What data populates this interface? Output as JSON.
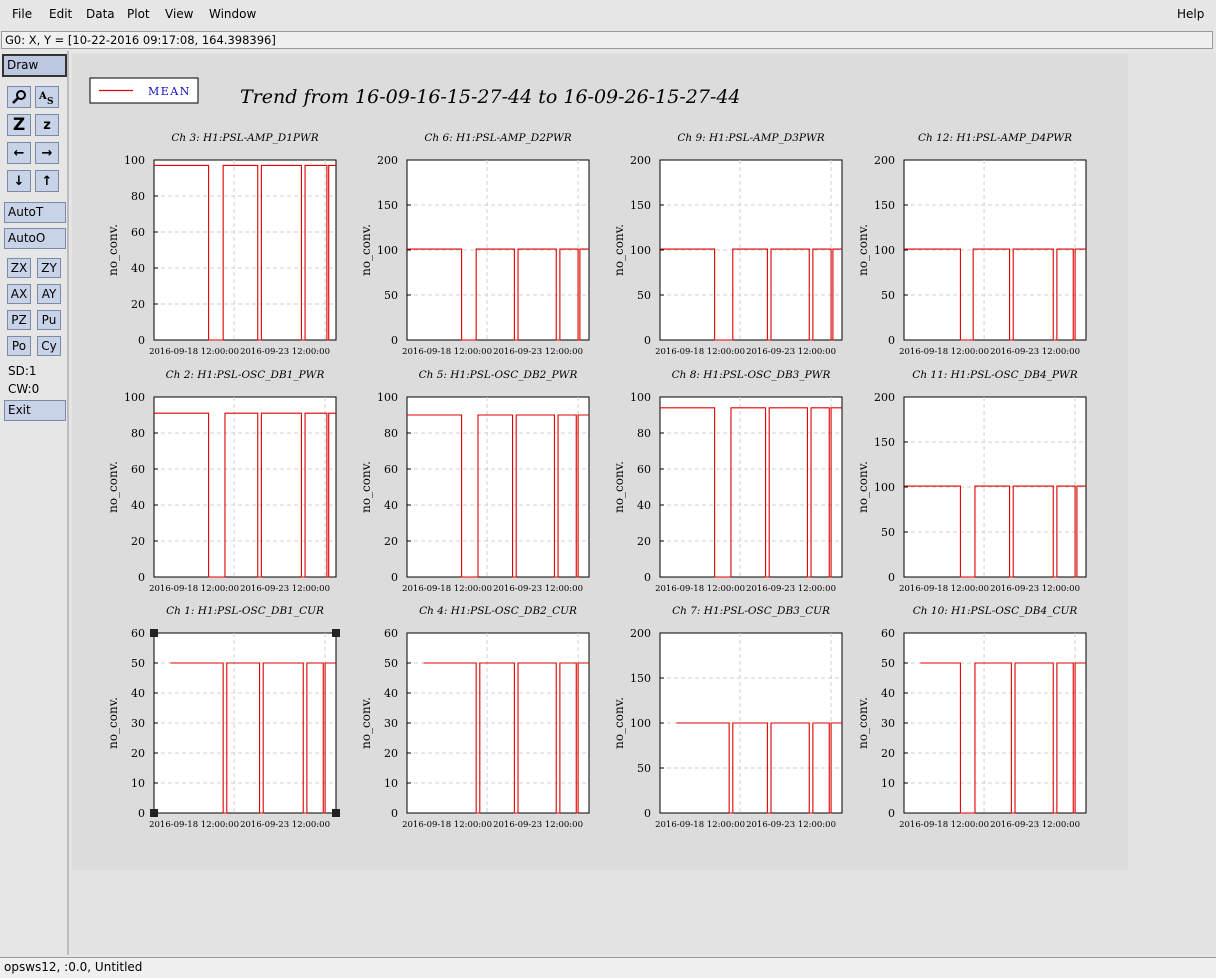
{
  "menu": {
    "file": "File",
    "edit": "Edit",
    "data": "Data",
    "plot": "Plot",
    "view": "View",
    "window": "Window",
    "help": "Help"
  },
  "coord_readout": "G0: X, Y = [10-22-2016 09:17:08, 164.398396]",
  "toolbar": {
    "draw": "Draw",
    "icons": [
      "magnifier-icon",
      "text-icon",
      "zoom-z-large-icon",
      "zoom-z-small-icon",
      "arrow-left-icon",
      "arrow-right-icon",
      "arrow-down-icon",
      "arrow-up-icon"
    ],
    "autot": "AutoT",
    "autoo": "AutoO",
    "zx": "ZX",
    "zy": "ZY",
    "ax": "AX",
    "ay": "AY",
    "pz": "PZ",
    "pu": "Pu",
    "po": "Po",
    "cy": "Cy",
    "sd": "SD:1",
    "cw": "CW:0",
    "exit": "Exit"
  },
  "figure": {
    "title": "Trend from 16-09-16-15-27-44 to 16-09-26-15-27-44",
    "legend": "MEAN",
    "series_color": "#e00000"
  },
  "status_bar": "opsws12, :0.0, Untitled",
  "chart_data": [
    {
      "type": "line",
      "title": "Ch 3: H1:PSL-AMP_D1PWR",
      "ylabel": "no_conv.",
      "ylim": [
        0,
        100
      ],
      "yticks": [
        0,
        20,
        40,
        60,
        80,
        100
      ],
      "xticks": [
        "2016-09-18 12:00:00",
        "2016-09-23 12:00:00"
      ],
      "level": 97,
      "start": 0.0,
      "drops": [
        [
          0.3,
          0.38
        ],
        [
          0.57,
          0.59
        ],
        [
          0.81,
          0.83
        ],
        [
          0.95,
          0.96
        ]
      ],
      "series": [
        {
          "name": "MEAN",
          "values": [
            97,
            97,
            0,
            97,
            0,
            97,
            0,
            97,
            0,
            97
          ]
        }
      ]
    },
    {
      "type": "line",
      "title": "Ch 6: H1:PSL-AMP_D2PWR",
      "ylabel": "no_conv.",
      "ylim": [
        0,
        200
      ],
      "yticks": [
        0,
        50,
        100,
        150,
        200
      ],
      "xticks": [
        "2016-09-18 12:00:00",
        "2016-09-23 12:00:00"
      ],
      "level": 101,
      "start": 0.0,
      "drops": [
        [
          0.3,
          0.38
        ],
        [
          0.59,
          0.61
        ],
        [
          0.82,
          0.84
        ],
        [
          0.94,
          0.95
        ]
      ],
      "series": [
        {
          "name": "MEAN",
          "values": [
            101,
            101,
            0,
            101,
            0,
            101,
            0,
            101,
            0,
            101
          ]
        }
      ]
    },
    {
      "type": "line",
      "title": "Ch 9: H1:PSL-AMP_D3PWR",
      "ylabel": "no_conv.",
      "ylim": [
        0,
        200
      ],
      "yticks": [
        0,
        50,
        100,
        150,
        200
      ],
      "xticks": [
        "2016-09-18 12:00:00",
        "2016-09-23 12:00:00"
      ],
      "level": 101,
      "start": 0.0,
      "drops": [
        [
          0.3,
          0.4
        ],
        [
          0.59,
          0.61
        ],
        [
          0.82,
          0.84
        ],
        [
          0.94,
          0.95
        ]
      ],
      "series": [
        {
          "name": "MEAN",
          "values": [
            101,
            101,
            0,
            101,
            0,
            101,
            0,
            101,
            0,
            101
          ]
        }
      ]
    },
    {
      "type": "line",
      "title": "Ch 12: H1:PSL-AMP_D4PWR",
      "ylabel": "no_conv.",
      "ylim": [
        0,
        200
      ],
      "yticks": [
        0,
        50,
        100,
        150,
        200
      ],
      "xticks": [
        "2016-09-18 12:00:00",
        "2016-09-23 12:00:00"
      ],
      "level": 101,
      "start": 0.0,
      "drops": [
        [
          0.31,
          0.38
        ],
        [
          0.58,
          0.6
        ],
        [
          0.82,
          0.84
        ],
        [
          0.93,
          0.94
        ]
      ],
      "series": [
        {
          "name": "MEAN",
          "values": [
            101,
            101,
            0,
            101,
            0,
            101,
            0,
            101,
            0,
            101
          ]
        }
      ]
    },
    {
      "type": "line",
      "title": "Ch 2: H1:PSL-OSC_DB1_PWR",
      "ylabel": "no_conv.",
      "ylim": [
        0,
        100
      ],
      "yticks": [
        0,
        20,
        40,
        60,
        80,
        100
      ],
      "xticks": [
        "2016-09-18 12:00:00",
        "2016-09-23 12:00:00"
      ],
      "level": 91,
      "start": 0.0,
      "drops": [
        [
          0.3,
          0.39
        ],
        [
          0.57,
          0.59
        ],
        [
          0.81,
          0.83
        ],
        [
          0.95,
          0.96
        ]
      ],
      "series": [
        {
          "name": "MEAN",
          "values": [
            91,
            91,
            0,
            91,
            0,
            91,
            0,
            91,
            0,
            91
          ]
        }
      ]
    },
    {
      "type": "line",
      "title": "Ch 5: H1:PSL-OSC_DB2_PWR",
      "ylabel": "no_conv.",
      "ylim": [
        0,
        100
      ],
      "yticks": [
        0,
        20,
        40,
        60,
        80,
        100
      ],
      "xticks": [
        "2016-09-18 12:00:00",
        "2016-09-23 12:00:00"
      ],
      "level": 90,
      "start": 0.0,
      "drops": [
        [
          0.3,
          0.39
        ],
        [
          0.58,
          0.6
        ],
        [
          0.81,
          0.83
        ],
        [
          0.93,
          0.94
        ]
      ],
      "series": [
        {
          "name": "MEAN",
          "values": [
            90,
            90,
            0,
            90,
            0,
            90,
            0,
            90,
            0,
            90
          ]
        }
      ]
    },
    {
      "type": "line",
      "title": "Ch 8: H1:PSL-OSC_DB3_PWR",
      "ylabel": "no_conv.",
      "ylim": [
        0,
        100
      ],
      "yticks": [
        0,
        20,
        40,
        60,
        80,
        100
      ],
      "xticks": [
        "2016-09-18 12:00:00",
        "2016-09-23 12:00:00"
      ],
      "level": 94,
      "start": 0.0,
      "drops": [
        [
          0.3,
          0.39
        ],
        [
          0.58,
          0.6
        ],
        [
          0.81,
          0.83
        ],
        [
          0.93,
          0.94
        ]
      ],
      "series": [
        {
          "name": "MEAN",
          "values": [
            94,
            94,
            0,
            94,
            0,
            94,
            0,
            94,
            0,
            94
          ]
        }
      ]
    },
    {
      "type": "line",
      "title": "Ch 11: H1:PSL-OSC_DB4_PWR",
      "ylabel": "no_conv.",
      "ylim": [
        0,
        200
      ],
      "yticks": [
        0,
        50,
        100,
        150,
        200
      ],
      "xticks": [
        "2016-09-18 12:00:00",
        "2016-09-23 12:00:00"
      ],
      "level": 101,
      "start": 0.0,
      "drops": [
        [
          0.31,
          0.39
        ],
        [
          0.58,
          0.6
        ],
        [
          0.82,
          0.84
        ],
        [
          0.94,
          0.95
        ]
      ],
      "series": [
        {
          "name": "MEAN",
          "values": [
            101,
            101,
            0,
            101,
            0,
            101,
            0,
            101,
            0,
            101
          ]
        }
      ]
    },
    {
      "type": "line",
      "title": "Ch 1: H1:PSL-OSC_DB1_CUR",
      "ylabel": "no_conv.",
      "ylim": [
        0,
        60
      ],
      "yticks": [
        0,
        10,
        20,
        30,
        40,
        50,
        60
      ],
      "xticks": [
        "2016-09-18 12:00:00",
        "2016-09-23 12:00:00"
      ],
      "level": 50,
      "start": 0.09,
      "drops": [
        [
          0.38,
          0.4
        ],
        [
          0.58,
          0.6
        ],
        [
          0.82,
          0.84
        ],
        [
          0.93,
          0.94
        ]
      ],
      "series": [
        {
          "name": "MEAN",
          "values": [
            0,
            50,
            0,
            50,
            0,
            50,
            0,
            50,
            0,
            50
          ]
        }
      ]
    },
    {
      "type": "line",
      "title": "Ch 4: H1:PSL-OSC_DB2_CUR",
      "ylabel": "no_conv.",
      "ylim": [
        0,
        60
      ],
      "yticks": [
        0,
        10,
        20,
        30,
        40,
        50,
        60
      ],
      "xticks": [
        "2016-09-18 12:00:00",
        "2016-09-23 12:00:00"
      ],
      "level": 50,
      "start": 0.09,
      "drops": [
        [
          0.38,
          0.4
        ],
        [
          0.59,
          0.61
        ],
        [
          0.82,
          0.84
        ],
        [
          0.93,
          0.94
        ]
      ],
      "series": [
        {
          "name": "MEAN",
          "values": [
            0,
            50,
            0,
            50,
            0,
            50,
            0,
            50,
            0,
            50
          ]
        }
      ]
    },
    {
      "type": "line",
      "title": "Ch 7: H1:PSL-OSC_DB3_CUR",
      "ylabel": "no_conv.",
      "ylim": [
        0,
        200
      ],
      "yticks": [
        0,
        50,
        100,
        150,
        200
      ],
      "xticks": [
        "2016-09-18 12:00:00",
        "2016-09-23 12:00:00"
      ],
      "level": 100,
      "start": 0.09,
      "drops": [
        [
          0.38,
          0.4
        ],
        [
          0.59,
          0.61
        ],
        [
          0.82,
          0.84
        ],
        [
          0.93,
          0.94
        ]
      ],
      "series": [
        {
          "name": "MEAN",
          "values": [
            0,
            100,
            0,
            100,
            0,
            100,
            0,
            100,
            0,
            100
          ]
        }
      ]
    },
    {
      "type": "line",
      "title": "Ch 10: H1:PSL-OSC_DB4_CUR",
      "ylabel": "no_conv.",
      "ylim": [
        0,
        60
      ],
      "yticks": [
        0,
        10,
        20,
        30,
        40,
        50,
        60
      ],
      "xticks": [
        "2016-09-18 12:00:00",
        "2016-09-23 12:00:00"
      ],
      "level": 50,
      "start": 0.09,
      "drops": [
        [
          0.31,
          0.39
        ],
        [
          0.59,
          0.61
        ],
        [
          0.82,
          0.84
        ],
        [
          0.93,
          0.94
        ]
      ],
      "series": [
        {
          "name": "MEAN",
          "values": [
            0,
            50,
            0,
            50,
            0,
            50,
            0,
            50,
            0,
            50
          ]
        }
      ]
    }
  ]
}
